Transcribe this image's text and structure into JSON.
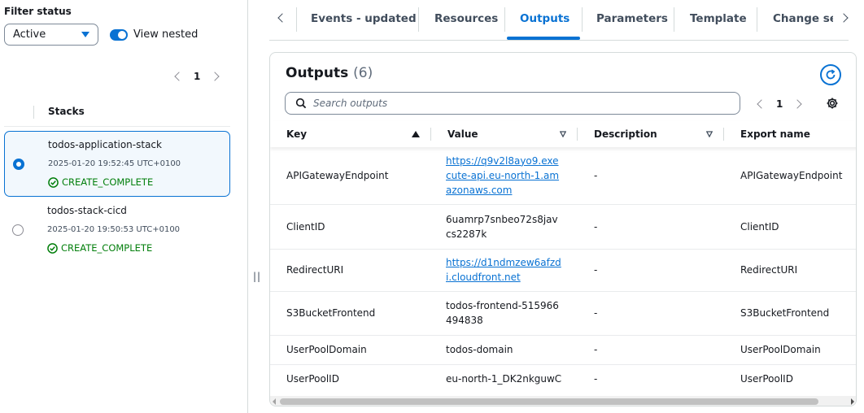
{
  "filter": {
    "label": "Filter status",
    "selected": "Active",
    "view_nested_label": "View nested",
    "view_nested_on": true
  },
  "stack_pager": {
    "page": "1"
  },
  "stacks": {
    "header": "Stacks",
    "items": [
      {
        "name": "todos-application-stack",
        "date": "2025-01-20 19:52:45 UTC+0100",
        "status": "CREATE_COMPLETE",
        "selected": true
      },
      {
        "name": "todos-stack-cicd",
        "date": "2025-01-20 19:50:53 UTC+0100",
        "status": "CREATE_COMPLETE",
        "selected": false
      }
    ]
  },
  "resize_handle": "||",
  "tabs": [
    {
      "label": "Events - updated"
    },
    {
      "label": "Resources"
    },
    {
      "label": "Outputs",
      "active": true
    },
    {
      "label": "Parameters"
    },
    {
      "label": "Template"
    },
    {
      "label": "Change set"
    }
  ],
  "outputs": {
    "title": "Outputs",
    "count": "(6)",
    "search_placeholder": "Search outputs",
    "page": "1",
    "columns": [
      "Key",
      "Value",
      "Description",
      "Export name"
    ],
    "rows": [
      {
        "key": "APIGatewayEndpoint",
        "value": "https://q9v2l8ayo9.execute-api.eu-north-1.amazonaws.com",
        "link": true,
        "description": "-",
        "export": "APIGatewayEndpoint"
      },
      {
        "key": "ClientID",
        "value": "6uamrp7snbeo72s8javcs2287k",
        "link": false,
        "description": "-",
        "export": "ClientID"
      },
      {
        "key": "RedirectURI",
        "value": "https://d1ndmzew6afzdi.cloudfront.net",
        "link": true,
        "description": "-",
        "export": "RedirectURI"
      },
      {
        "key": "S3BucketFrontend",
        "value": "todos-frontend-515966494838",
        "link": false,
        "description": "-",
        "export": "S3BucketFrontend"
      },
      {
        "key": "UserPoolDomain",
        "value": "todos-domain",
        "link": false,
        "description": "-",
        "export": "UserPoolDomain"
      },
      {
        "key": "UserPoolID",
        "value": "eu-north-1_DK2nkguwC",
        "link": false,
        "description": "-",
        "export": "UserPoolID"
      }
    ]
  },
  "colors": {
    "accent": "#0972d3",
    "success": "#037f0c",
    "border": "#d5dbdb"
  }
}
